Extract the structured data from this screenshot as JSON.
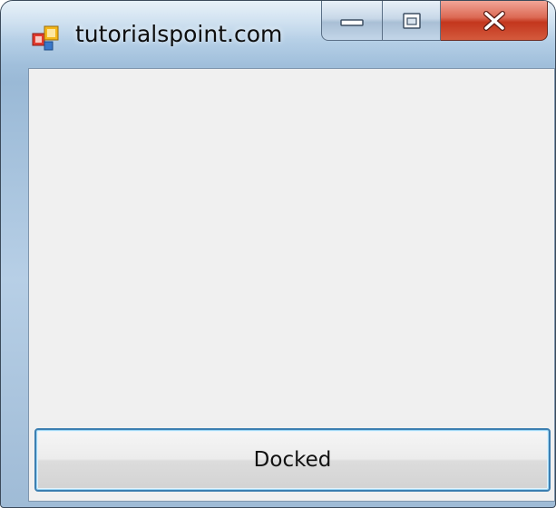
{
  "window": {
    "title": "tutorialspoint.com",
    "controls": {
      "minimize": "minimize",
      "maximize": "maximize",
      "close": "close"
    },
    "colors": {
      "frame": "#a9c7e2",
      "close_button": "#c3361d",
      "client_background": "#f0f0f0",
      "button_focus_border": "#3c7fb1"
    }
  },
  "form": {
    "docked_button_label": "Docked"
  },
  "icons": {
    "app": "windows-forms-app-icon",
    "minimize": "minimize-icon",
    "maximize": "maximize-icon",
    "close": "close-x-icon"
  }
}
